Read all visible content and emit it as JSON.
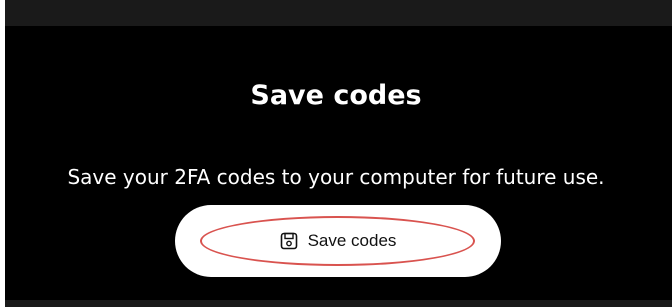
{
  "dialog": {
    "title": "Save codes",
    "description": "Save your 2FA codes to your computer for future use.",
    "save_button": {
      "label": "Save codes",
      "icon": "save-icon"
    }
  },
  "colors": {
    "background": "#000000",
    "text": "#ffffff",
    "button_background": "#ffffff",
    "button_text": "#111111",
    "highlight": "#d9534f"
  }
}
